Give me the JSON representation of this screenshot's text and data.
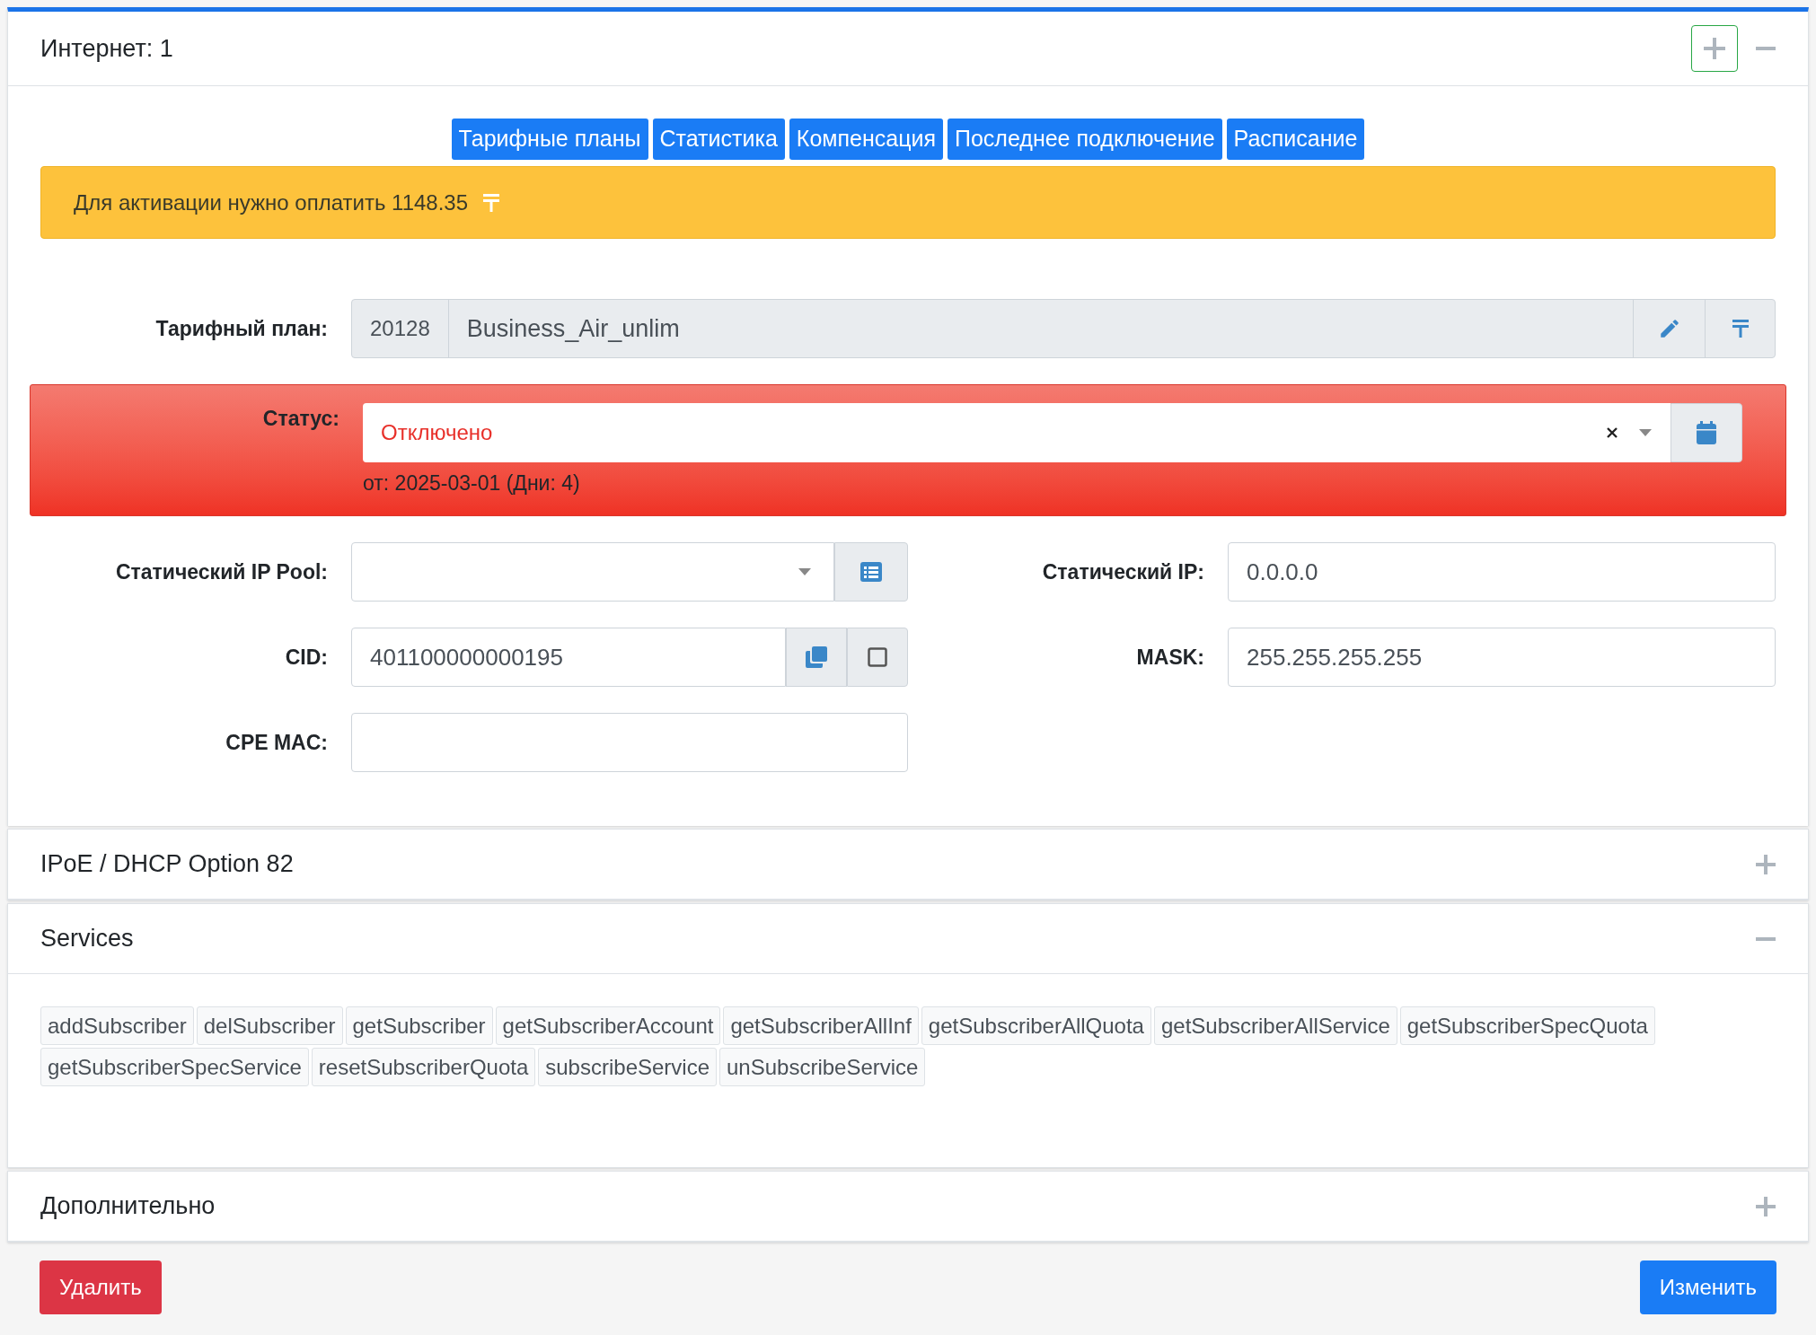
{
  "panel": {
    "title": "Интернет: 1",
    "expanded": true
  },
  "tabs": [
    {
      "label": "Тарифные планы"
    },
    {
      "label": "Статистика"
    },
    {
      "label": "Компенсация"
    },
    {
      "label": "Последнее подключение"
    },
    {
      "label": "Расписание"
    }
  ],
  "alert": {
    "text": "Для активации нужно оплатить 1148.35"
  },
  "tariff": {
    "label": "Тарифный план:",
    "code": "20128",
    "name": "Business_Air_unlim"
  },
  "status": {
    "label": "Статус:",
    "value": "Отключено",
    "since": "от: 2025-03-01 (Дни: 4)"
  },
  "left_fields": [
    {
      "kind": "select",
      "label": "Статический IP Pool:"
    },
    {
      "kind": "cid",
      "label": "CID:",
      "value": "401100000000195",
      "checked": false
    },
    {
      "kind": "text",
      "label": "CPE MAC:"
    }
  ],
  "right_fields": [
    {
      "label": "Статический IP:",
      "value": "0.0.0.0"
    },
    {
      "label": "MASK:",
      "value": "255.255.255.255"
    }
  ],
  "sections": [
    {
      "title": "IPoE / DHCP Option 82",
      "expanded": false
    },
    {
      "title": "Services",
      "expanded": true,
      "tags": [
        "addSubscriber",
        "delSubscriber",
        "getSubscriber",
        "getSubscriberAccount",
        "getSubscriberAllInf",
        "getSubscriberAllQuota",
        "getSubscriberAllService",
        "getSubscriberSpecQuota",
        "getSubscriberSpecService",
        "resetSubscriberQuota",
        "subscribeService",
        "unSubscribeService"
      ]
    },
    {
      "title": "Дополнительно",
      "expanded": false
    }
  ],
  "buttons": {
    "delete": "Удалить",
    "edit": "Изменить"
  }
}
